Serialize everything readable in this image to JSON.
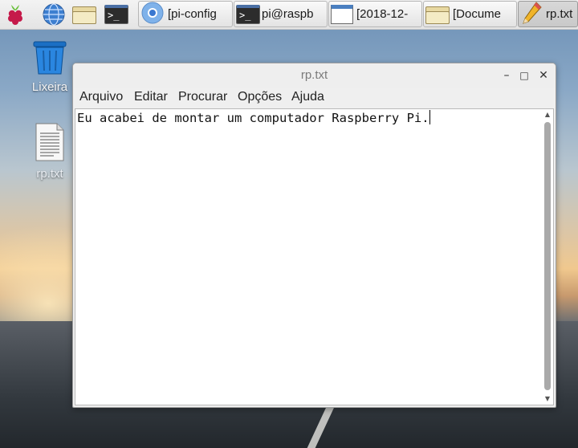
{
  "taskbar": {
    "launchers": [
      {
        "icon": "raspberry-menu-icon"
      },
      {
        "icon": "web-browser-icon"
      },
      {
        "icon": "file-manager-icon"
      },
      {
        "icon": "terminal-icon",
        "text": ">_"
      }
    ],
    "tasks": [
      {
        "label": "[pi-config",
        "icon": "chromium-icon"
      },
      {
        "label": "pi@raspb",
        "icon": "terminal-icon",
        "icon_text": ">_"
      },
      {
        "label": "[2018-12-",
        "icon": "window-icon"
      },
      {
        "label": "[Docume",
        "icon": "folder-icon"
      },
      {
        "label": "rp.txt",
        "icon": "pencil-icon",
        "active": true
      }
    ]
  },
  "desktop": {
    "icons": [
      {
        "label": "Lixeira",
        "icon": "trash-icon"
      },
      {
        "label": "rp.txt",
        "icon": "text-file-icon"
      }
    ]
  },
  "window": {
    "title": "rp.txt",
    "controls": {
      "minimize": "–",
      "maximize": "□",
      "close": "✕"
    },
    "menu": [
      "Arquivo",
      "Editar",
      "Procurar",
      "Opções",
      "Ajuda"
    ],
    "editor_text": "Eu acabei de montar um computador Raspberry Pi."
  },
  "colors": {
    "accent_blue": "#4a7fc0",
    "raspberry_red": "#c51a4a"
  }
}
